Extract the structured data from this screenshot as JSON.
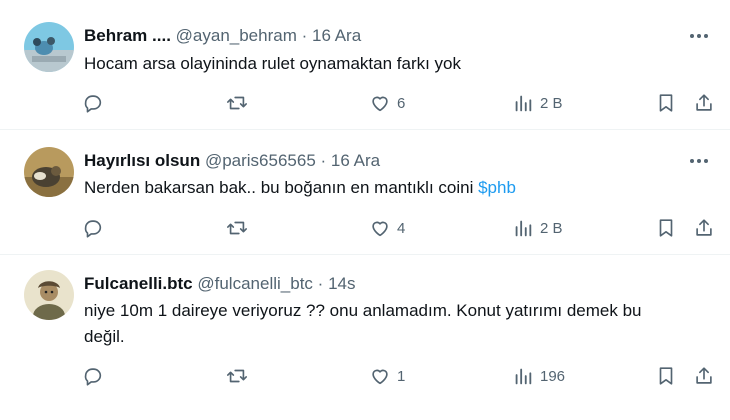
{
  "tweets": [
    {
      "name": "Behram ....",
      "handle": "@ayan_behram",
      "separator": "·",
      "time": "16 Ara",
      "text": "Hocam arsa olayininda rulet oynamaktan farkı yok",
      "likes": "6",
      "views": "2 B"
    },
    {
      "name": "Hayırlısı olsun",
      "handle": "@paris656565",
      "separator": "·",
      "time": "16 Ara",
      "text": "Nerden bakarsan bak.. bu boğanın en mantıklı coini ",
      "cashtag": "$phb",
      "likes": "4",
      "views": "2 B"
    },
    {
      "name": "Fulcanelli.btc",
      "handle": "@fulcanelli_btc",
      "separator": "·",
      "time": "14s",
      "text_line1": "niye 10m 1 daireye veriyoruz ?? onu anlamadım. Konut yatırımı demek bu",
      "text_line2": "değil.",
      "likes": "1",
      "views": "196"
    }
  ],
  "icons": {
    "reply": "reply-icon",
    "retweet": "retweet-icon",
    "like": "heart-icon",
    "views": "views-icon",
    "bookmark": "bookmark-icon",
    "share": "share-icon",
    "more": "more-icon"
  },
  "colors": {
    "text": "#0f1419",
    "secondary": "#536471",
    "link": "#1d9bf0",
    "divider": "#eff3f4"
  }
}
